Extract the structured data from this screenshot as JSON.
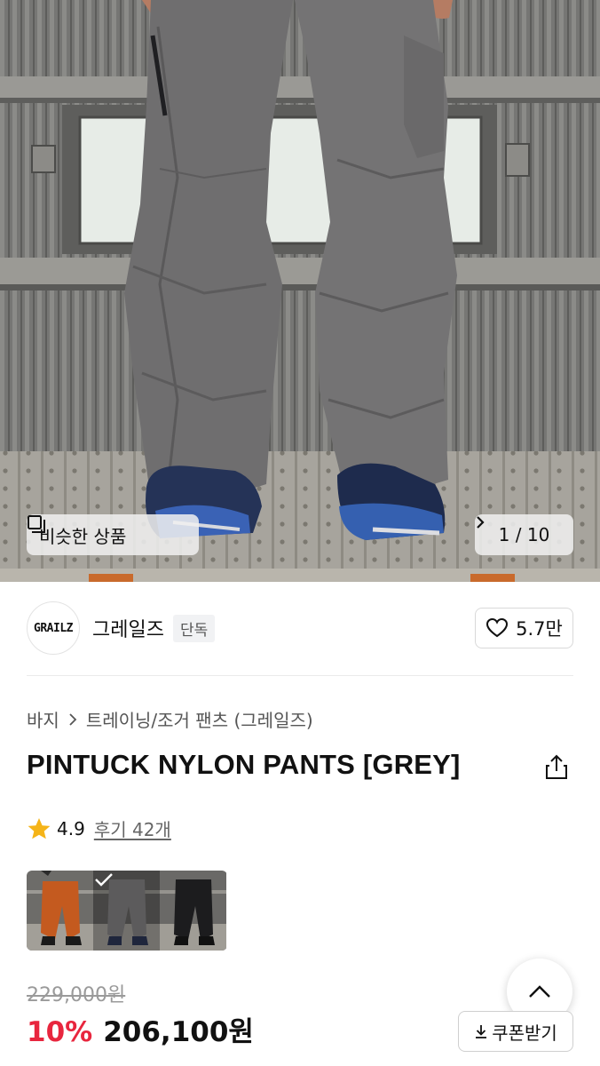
{
  "gallery": {
    "similar_label": "비슷한 상품",
    "counter": "1 / 10"
  },
  "brand": {
    "logo_text": "GRAILZ",
    "name": "그레일즈",
    "badge": "단독",
    "likes": "5.7만"
  },
  "breadcrumb": {
    "category": "바지",
    "subcategory": "트레이닝/조거 팬츠 (그레일즈)"
  },
  "product": {
    "title": "PINTUCK NYLON PANTS [GREY]"
  },
  "rating": {
    "score": "4.9",
    "reviews": "후기 42개"
  },
  "options": [
    {
      "color": "orange",
      "selected": false
    },
    {
      "color": "grey",
      "selected": true
    },
    {
      "color": "black",
      "selected": false
    }
  ],
  "price": {
    "original": "229,000원",
    "discount": "10%",
    "sale": "206,100원",
    "coupon_label": "쿠폰받기"
  },
  "colors": {
    "discount_red": "#e8263e",
    "star_yellow": "#f5b418"
  }
}
